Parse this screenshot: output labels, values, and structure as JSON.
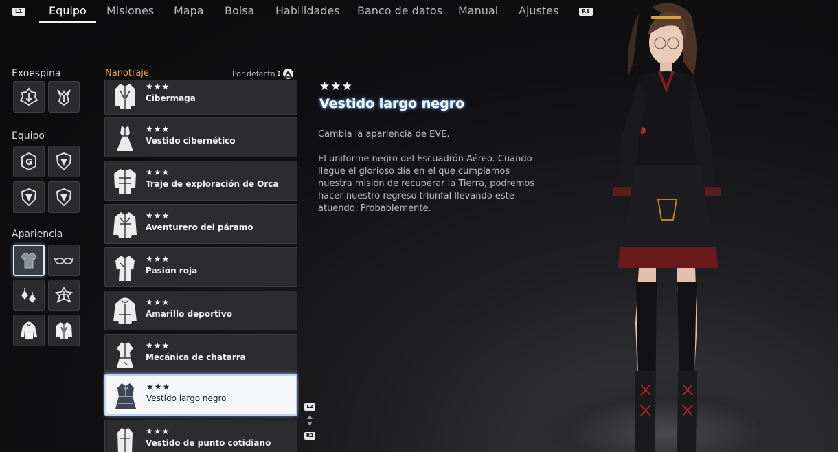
{
  "nav": {
    "left_button": "L1",
    "right_button": "R1",
    "tabs": [
      {
        "label": "Equipo",
        "active": true
      },
      {
        "label": "Misiones"
      },
      {
        "label": "Mapa"
      },
      {
        "label": "Bolsa"
      },
      {
        "label": "Habilidades"
      },
      {
        "label": "Banco de datos"
      },
      {
        "label": "Manual"
      },
      {
        "label": "Ajustes"
      }
    ]
  },
  "sidebar": {
    "exospine_label": "Exoespina",
    "equipment_label": "Equipo",
    "appearance_label": "Apariencia",
    "selected_slot": "appearance-outfit"
  },
  "list": {
    "category": "Nanotraje",
    "sort_label": "Por defecto",
    "sort_button_icon": "triangle-button-icon",
    "scroll_up_button": "L2",
    "scroll_down_button": "R2",
    "items": [
      {
        "stars": "★★★",
        "name": "Cibermaga"
      },
      {
        "stars": "★★★",
        "name": "Vestido cibernético"
      },
      {
        "stars": "★★★",
        "name": "Traje de exploración de Orca"
      },
      {
        "stars": "★★★",
        "name": "Aventurero del páramo"
      },
      {
        "stars": "★★★",
        "name": "Pasión roja"
      },
      {
        "stars": "★★★",
        "name": "Amarillo deportivo"
      },
      {
        "stars": "★★★",
        "name": "Mecánica de chatarra"
      },
      {
        "stars": "★★★",
        "name": "Vestido largo negro",
        "selected": true
      },
      {
        "stars": "★★★",
        "name": "Vestido de punto cotidiano"
      }
    ]
  },
  "detail": {
    "stars": "★★★",
    "title": "Vestido largo negro",
    "effect": "Cambia la apariencia de EVE.",
    "description": "El uniforme negro del Escuadrón Aéreo. Cuando llegue el glorioso día en el que cumplamos nuestra misión de recuperar la Tierra, podremos hacer nuestro regreso triunfal llevando este atuendo. Probablemente."
  },
  "colors": {
    "accent_orange": "#f0a25a",
    "title_glow": "#6aa6ff",
    "selection_border": "#bcd3f2"
  }
}
